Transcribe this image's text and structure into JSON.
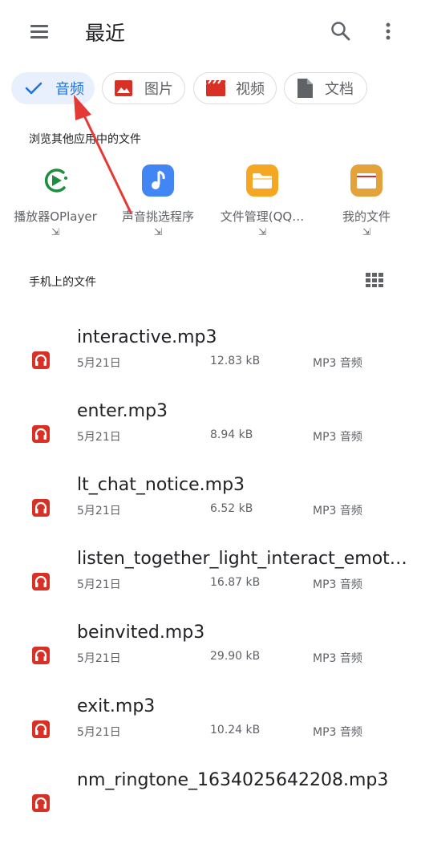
{
  "header": {
    "title": "最近",
    "menu_icon": "hamburger-icon",
    "search_icon": "search-icon",
    "more_icon": "more-vert-icon"
  },
  "filters": [
    {
      "label": "音频",
      "icon": "check-icon",
      "selected": true
    },
    {
      "label": "图片",
      "icon": "image-icon",
      "selected": false
    },
    {
      "label": "视频",
      "icon": "video-icon",
      "selected": false
    },
    {
      "label": "文档",
      "icon": "document-icon",
      "selected": false
    }
  ],
  "apps_section": {
    "label": "浏览其他应用中的文件",
    "apps": [
      {
        "name": "播放器OPlayer",
        "open_glyph": "⇲",
        "icon": "play-circle-icon",
        "color": "#1e8e3e"
      },
      {
        "name": "声音挑选程序",
        "open_glyph": "⇲",
        "icon": "music-note-icon",
        "color": "#4285f4"
      },
      {
        "name": "文件管理(QQ…",
        "open_glyph": "⇲",
        "icon": "folder-icon",
        "color": "#f5a623"
      },
      {
        "name": "我的文件",
        "open_glyph": "⇲",
        "icon": "folder-icon",
        "color": "#e3a33a"
      }
    ]
  },
  "files_section": {
    "label": "手机上的文件",
    "grid_icon": "grid-view-icon"
  },
  "files": [
    {
      "name": "interactive.mp3",
      "date": "5月21日",
      "size": "12.83 kB",
      "type": "MP3 音频"
    },
    {
      "name": "enter.mp3",
      "date": "5月21日",
      "size": "8.94 kB",
      "type": "MP3 音频"
    },
    {
      "name": "lt_chat_notice.mp3",
      "date": "5月21日",
      "size": "6.52 kB",
      "type": "MP3 音频"
    },
    {
      "name": "listen_together_light_interact_emot…",
      "date": "5月21日",
      "size": "16.87 kB",
      "type": "MP3 音频"
    },
    {
      "name": "beinvited.mp3",
      "date": "5月21日",
      "size": "29.90 kB",
      "type": "MP3 音频"
    },
    {
      "name": "exit.mp3",
      "date": "5月21日",
      "size": "10.24 kB",
      "type": "MP3 音频"
    },
    {
      "name": "nm_ringtone_1634025642208.mp3",
      "date": "",
      "size": "",
      "type": ""
    }
  ],
  "colors": {
    "accent": "#1a73e8",
    "chip_selected_bg": "#e8f0fe",
    "audio_icon": "#d93025",
    "annotation_arrow": "#e53935"
  }
}
